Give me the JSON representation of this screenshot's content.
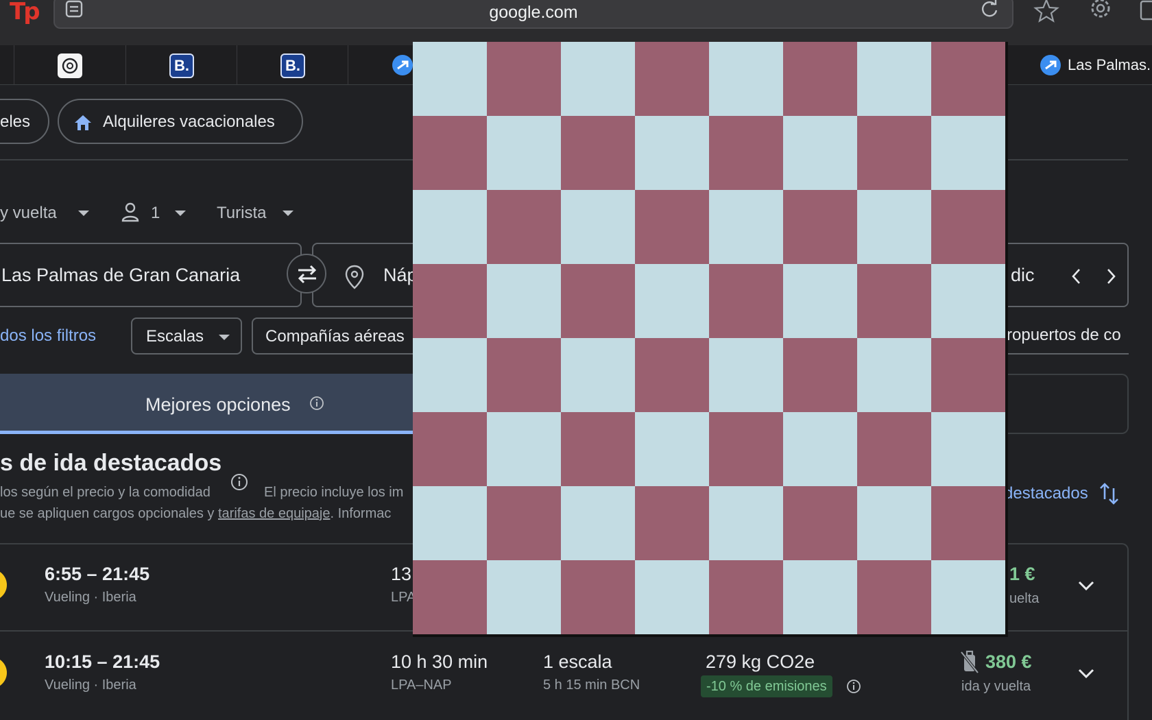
{
  "browser": {
    "url": "google.com",
    "tab_title": "Las Palmas.",
    "booking_badge": "B.",
    "icons": [
      "page-icon",
      "reload-icon",
      "star-icon",
      "gear-icon"
    ]
  },
  "nav_chips": {
    "hotels_fragment": "eles",
    "vacation_rentals": "Alquileres vacacionales"
  },
  "search": {
    "trip_type": "y vuelta",
    "passengers": "1",
    "cabin": "Turista",
    "origin": "Las Palmas de Gran Canaria",
    "destination": "Náp",
    "date_fragment": "dic"
  },
  "filters": {
    "all_filters": "dos los filtros",
    "stops": "Escalas",
    "airlines": "Compañías aéreas",
    "airports": "ropuertos de co"
  },
  "tabs": {
    "best": "Mejores opciones"
  },
  "section": {
    "title": "s de ida destacados",
    "subtitle_line1": "los según el precio y la comodidad",
    "price_note": "El precio incluye los im",
    "subtitle_line2_pre": "ue se apliquen cargos opcionales y ",
    "baggage_link": "tarifas de equipaje",
    "subtitle_line2_post": ". Informac",
    "sort_label": "destacados"
  },
  "flights": [
    {
      "times": "6:55 – 21:45",
      "airlines": "Vueling · Iberia",
      "duration": "13",
      "route": "LPA",
      "price": "1 €",
      "price_note": "uelta"
    },
    {
      "times": "10:15 – 21:45",
      "airlines": "Vueling · Iberia",
      "duration": "10 h 30 min",
      "route": "LPA–NAP",
      "stops": "1 escala",
      "layover": "5 h 15 min BCN",
      "emissions": "279 kg CO2e",
      "emissions_badge": "-10 % de emisiones",
      "price": "380 €",
      "price_note": "ida y vuelta"
    }
  ],
  "overlay": {
    "type": "checkerboard",
    "rows": 8,
    "cols": 8,
    "light_color": "#c3dce3",
    "dark_color": "#9a6070"
  }
}
